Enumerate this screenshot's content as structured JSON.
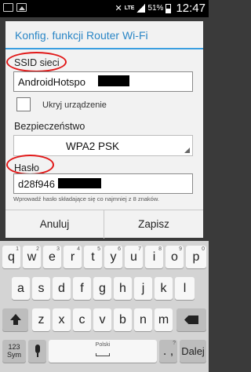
{
  "status_bar": {
    "battery": "51%",
    "network": "LTE",
    "time": "12:47",
    "icons": [
      "screenshot-icon",
      "image-icon",
      "mute-icon",
      "signal-icon",
      "battery-icon"
    ]
  },
  "dialog": {
    "title": "Konfig. funkcji Router Wi-Fi",
    "ssid_label": "SSID sieci",
    "ssid_value": "AndroidHotspo",
    "hide_device_label": "Ukryj urządzenie",
    "security_label": "Bezpieczeństwo",
    "security_value": "WPA2 PSK",
    "password_label": "Hasło",
    "password_value": "d28f946",
    "password_hint": "Wprowadź hasło składające się co najmniej z 8 znaków.",
    "cancel_label": "Anuluj",
    "save_label": "Zapisz"
  },
  "keyboard": {
    "row1": [
      {
        "label": "q",
        "hint": "1"
      },
      {
        "label": "w",
        "hint": "2"
      },
      {
        "label": "e",
        "hint": "3"
      },
      {
        "label": "r",
        "hint": "4"
      },
      {
        "label": "t",
        "hint": "5"
      },
      {
        "label": "y",
        "hint": "6"
      },
      {
        "label": "u",
        "hint": "7"
      },
      {
        "label": "i",
        "hint": "8"
      },
      {
        "label": "o",
        "hint": "9"
      },
      {
        "label": "p",
        "hint": "0"
      }
    ],
    "row2": [
      "a",
      "s",
      "d",
      "f",
      "g",
      "h",
      "j",
      "k",
      "l"
    ],
    "row3": [
      "z",
      "x",
      "c",
      "v",
      "b",
      "n",
      "m"
    ],
    "sym_label": "123\nSym",
    "space_label": "Polski",
    "punct_label": ". ,",
    "punct_hint": "?",
    "enter_label": "Dalej"
  },
  "colors": {
    "accent": "#2a86c6",
    "highlight": "#e11818"
  }
}
